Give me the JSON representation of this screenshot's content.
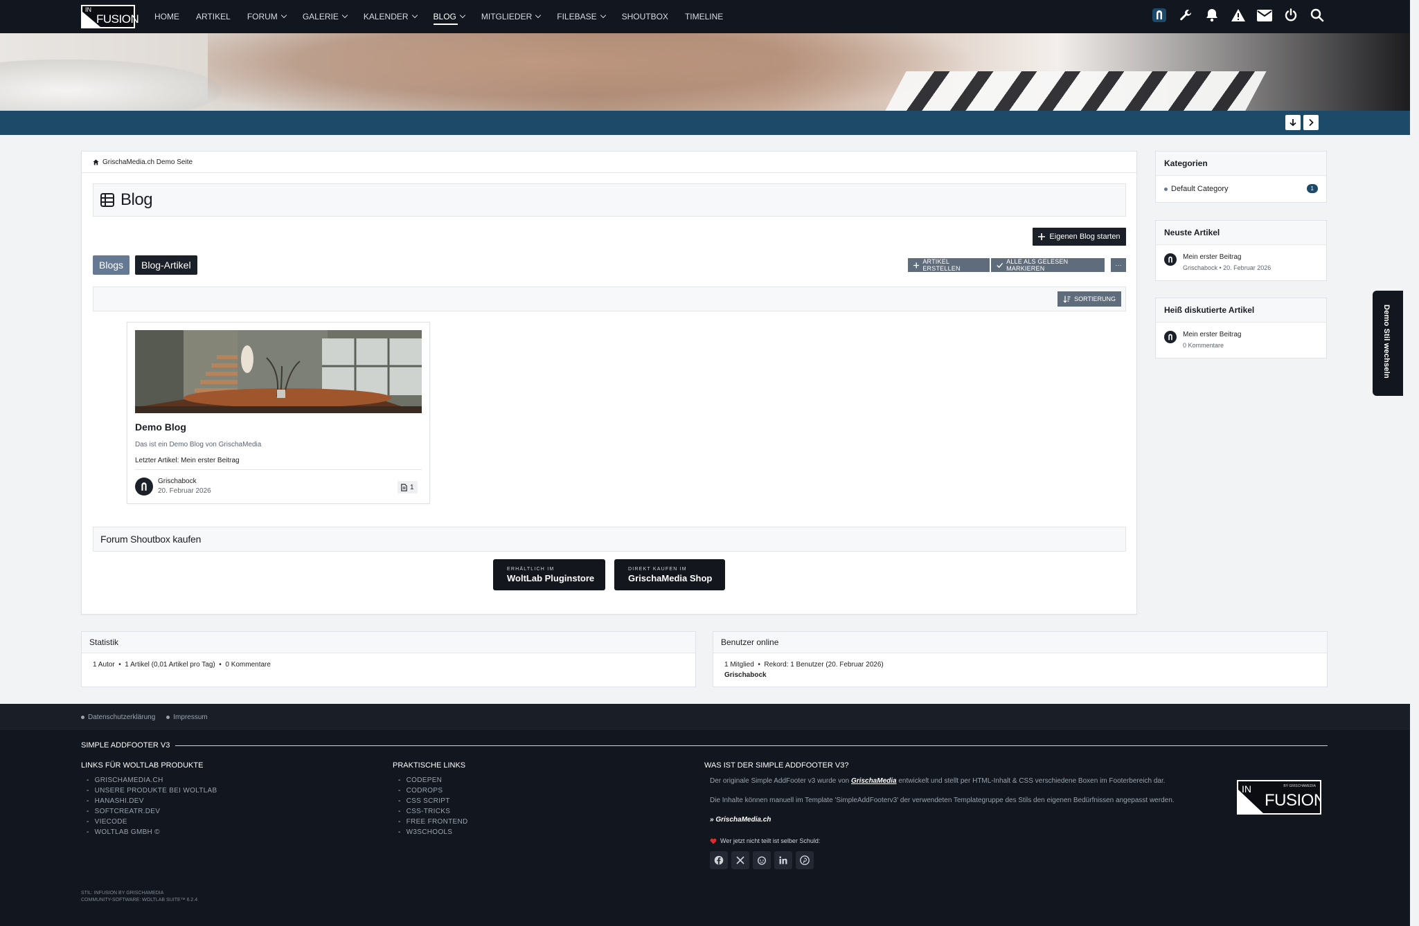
{
  "nav": {
    "items": [
      {
        "label": "HOME",
        "dropdown": false
      },
      {
        "label": "ARTIKEL",
        "dropdown": false
      },
      {
        "label": "FORUM",
        "dropdown": true
      },
      {
        "label": "GALERIE",
        "dropdown": true
      },
      {
        "label": "KALENDER",
        "dropdown": true
      },
      {
        "label": "BLOG",
        "dropdown": true,
        "active": true
      },
      {
        "label": "MITGLIEDER",
        "dropdown": true
      },
      {
        "label": "FILEBASE",
        "dropdown": true
      },
      {
        "label": "SHOUTBOX",
        "dropdown": false
      },
      {
        "label": "TIMELINE",
        "dropdown": false
      }
    ],
    "user_icons": [
      "avatar-icon",
      "wrench-icon",
      "bell-icon",
      "warning-icon",
      "mail-icon",
      "power-icon",
      "search-icon"
    ]
  },
  "logo": {
    "prefix": "IN",
    "name": "FUSION"
  },
  "breadcrumb": {
    "label": "GrischaMedia.ch Demo Seite"
  },
  "page": {
    "title": "Blog"
  },
  "buttons": {
    "start_blog": "Eigenen Blog starten",
    "create_article": "ARTIKEL ERSTELLEN",
    "mark_read": "ALLE ALS GELESEN MARKIEREN",
    "more": "···",
    "sort": "SORTIERUNG"
  },
  "tabs": {
    "blogs": "Blogs",
    "articles": "Blog-Artikel"
  },
  "blog_card": {
    "title": "Demo Blog",
    "description": "Das ist ein Demo Blog von GrischaMedia",
    "last_article": "Letzter Artikel: Mein erster Beitrag",
    "author": "Grischabock",
    "date": "20. Februar 2026",
    "count": "1"
  },
  "shoutbox": {
    "heading": "Forum Shoutbox kaufen",
    "btn1_small": "ERHÄLTLICH IM",
    "btn1_big": "WoltLab Pluginstore",
    "btn2_small": "DIREKT KAUFEN IM",
    "btn2_big": "GrischaMedia Shop"
  },
  "sidebar": {
    "categories": {
      "title": "Kategorien",
      "item": "Default Category",
      "count": "1"
    },
    "latest": {
      "title": "Neuste Artikel",
      "article": "Mein erster Beitrag",
      "meta": "Grischabock • 20. Februar 2026"
    },
    "hot": {
      "title": "Heiß diskutierte Artikel",
      "article": "Mein erster Beitrag",
      "meta": "0 Kommentare"
    }
  },
  "style_switch": {
    "label": "Demo Stil wechseln"
  },
  "stats": {
    "title": "Statistik",
    "text": "1 Autor  •  1 Artikel (0,01 Artikel pro Tag)  •  0 Kommentare"
  },
  "online": {
    "title": "Benutzer online",
    "text": "1 Mitglied  •  Rekord: 1 Benutzer (20. Februar 2026)",
    "user": "Grischabock"
  },
  "footer": {
    "links": [
      "Datenschutzerklärung",
      "Impressum"
    ],
    "addfooter_title": "SIMPLE ADDFOOTER V3",
    "col1": {
      "title": "LINKS FÜR WOLTLAB PRODUKTE",
      "items": [
        "GRISCHAMEDIA.CH",
        "UNSERE PRODUKTE BEI WOLTLAB",
        "HANASHI.DEV",
        "SOFTCREATR.DEV",
        "VIECODE",
        "WOLTLAB GMBH ©"
      ]
    },
    "col2": {
      "title": "PRAKTISCHE LINKS",
      "items": [
        "CODEPEN",
        "CODROPS",
        "CSS SCRIPT",
        "CSS-TRICKS",
        "FREE FRONTEND",
        "W3SCHOOLS"
      ]
    },
    "col3": {
      "title": "WAS IST DER SIMPLE ADDFOOTER V3?",
      "p1_before": "Der originale Simple AddFooter v3 wurde von ",
      "p1_link": "GrischaMedia",
      "p1_after": " entwickelt und stellt per HTML-Inhalt & CSS verschiedene Boxen im Footerbereich dar.",
      "p2": "Die Inhalte können manuell im Template 'SimpleAddFooterv3' der verwendeten Templategruppe des Stils den eigenen Bedürfnissen angepasst werden.",
      "link": "» GrischaMedia.ch",
      "share": "Wer jetzt nicht teilt ist selber Schuld:",
      "socials": [
        "facebook-icon",
        "x-icon",
        "reddit-icon",
        "linkedin-icon",
        "pinterest-icon"
      ]
    },
    "logo_sub": "BY GRISCHAMEDIA",
    "credit1": "STIL: INFUSION BY GRISCHAMEDIA",
    "credit2": "COMMUNITY-SOFTWARE: WOLTLAB SUITE™ 6.2.4"
  },
  "colors": {
    "topbar": "#12161e",
    "band": "#1d4a68",
    "accent_button": "#5f6c7b",
    "tab_blogs": "#657a92"
  }
}
